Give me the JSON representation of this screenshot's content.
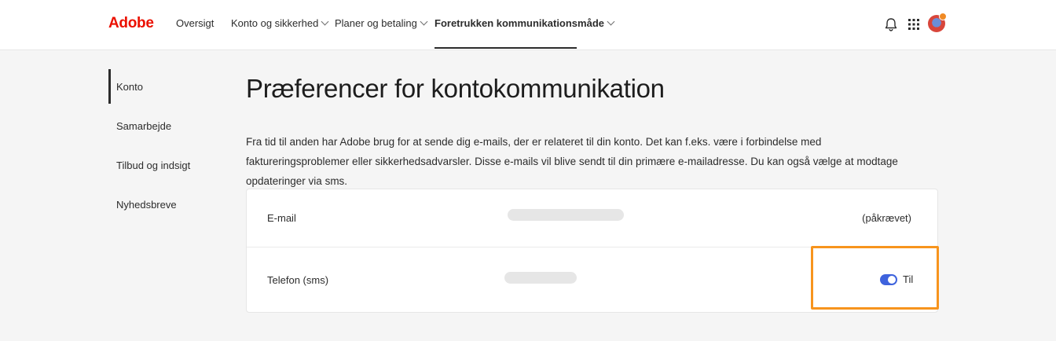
{
  "header": {
    "logo": "Adobe",
    "nav": [
      {
        "label": "Oversigt",
        "has_dropdown": false
      },
      {
        "label": "Konto og sikkerhed",
        "has_dropdown": true
      },
      {
        "label": "Planer og betaling",
        "has_dropdown": true
      },
      {
        "label": "Foretrukken kommunikationsmåde",
        "has_dropdown": true,
        "active": true
      }
    ],
    "icons": [
      "bell-icon",
      "apps-grid-icon",
      "avatar"
    ],
    "brand_color": "#eb1000"
  },
  "sidebar": {
    "items": [
      {
        "label": "Konto",
        "active": true
      },
      {
        "label": "Samarbejde"
      },
      {
        "label": "Tilbud og indsigt"
      },
      {
        "label": "Nyhedsbreve"
      }
    ]
  },
  "main": {
    "title": "Præferencer for kontokommunikation",
    "description": "Fra tid til anden har Adobe brug for at sende dig e-mails, der er relateret til din konto. Det kan f.eks. være i forbindelse med faktureringsproblemer eller sikkerhedsadvarsler. Disse e-mails vil blive sendt til din primære e-mailadresse. Du kan også vælge at modtage opdateringer via sms.",
    "rows": [
      {
        "label": "E-mail",
        "status": "(påkrævet)"
      },
      {
        "label": "Telefon (sms)",
        "toggle_on": true,
        "toggle_label": "Til"
      }
    ],
    "toggle_color": "#3e63dd",
    "highlight_color": "#f7941d"
  }
}
